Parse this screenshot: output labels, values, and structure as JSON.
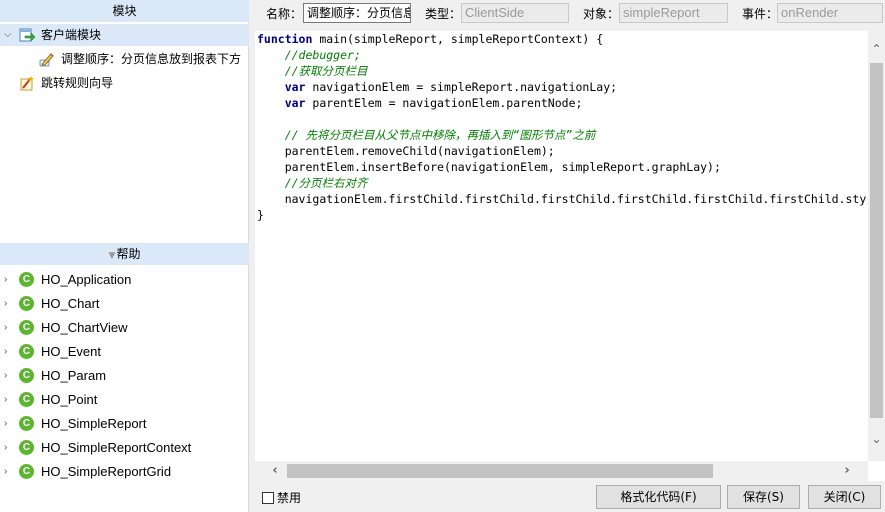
{
  "modules": {
    "header": "模块",
    "client_module": "客户端模块",
    "adjust_order": "调整顺序：分页信息放到报表下方",
    "jump_wizard": "跳转规则向导"
  },
  "help": {
    "header": "帮助",
    "items": [
      "HO_Application",
      "HO_Chart",
      "HO_ChartView",
      "HO_Event",
      "HO_Param",
      "HO_Point",
      "HO_SimpleReport",
      "HO_SimpleReportContext",
      "HO_SimpleReportGrid"
    ],
    "class_glyph": "C"
  },
  "fields": {
    "name_label": "名称：",
    "name_value": "调整顺序：分页信息放到报表下方",
    "type_label": "类型：",
    "type_value": "ClientSide",
    "object_label": "对象：",
    "object_value": "simpleReport",
    "event_label": "事件：",
    "event_value": "onRender"
  },
  "code": {
    "kw_function": "function",
    "sig": " main(simpleReport, simpleReportContext) {",
    "c1": "//debugger;",
    "c2": "//获取分页栏目",
    "kw_var1": "var",
    "l3": " navigationElem = simpleReport.navigationLay;",
    "kw_var2": "var",
    "l4": " parentElem = navigationElem.parentNode;",
    "c5": "// 先将分页栏目从父节点中移除，再插入到“图形节点”之前",
    "l6": "parentElem.removeChild(navigationElem);",
    "l7": "parentElem.insertBefore(navigationElem, simpleReport.graphLay);",
    "c8": "//分页栏右对齐",
    "l9": "navigationElem.firstChild.firstChild.firstChild.firstChild.firstChild.firstChild.style.textAlign = \"right\";",
    "close": "}"
  },
  "bottom": {
    "disable_label": "禁用",
    "format_button": "格式化代码(F)",
    "save_button": "保存(S)",
    "close_button": "关闭(C)"
  },
  "icons": {
    "tree_expanded": "chevron-down-icon",
    "tree_collapsed": "chevron-right-icon",
    "client_module": "module-arrow-icon",
    "script": "script-pencil-icon",
    "wizard": "wizard-icon",
    "class": "class-c-icon"
  },
  "colors": {
    "selection": "#dbe8f7",
    "keyword": "#00007f",
    "comment": "#007f00",
    "class_icon": "#5bb531"
  }
}
